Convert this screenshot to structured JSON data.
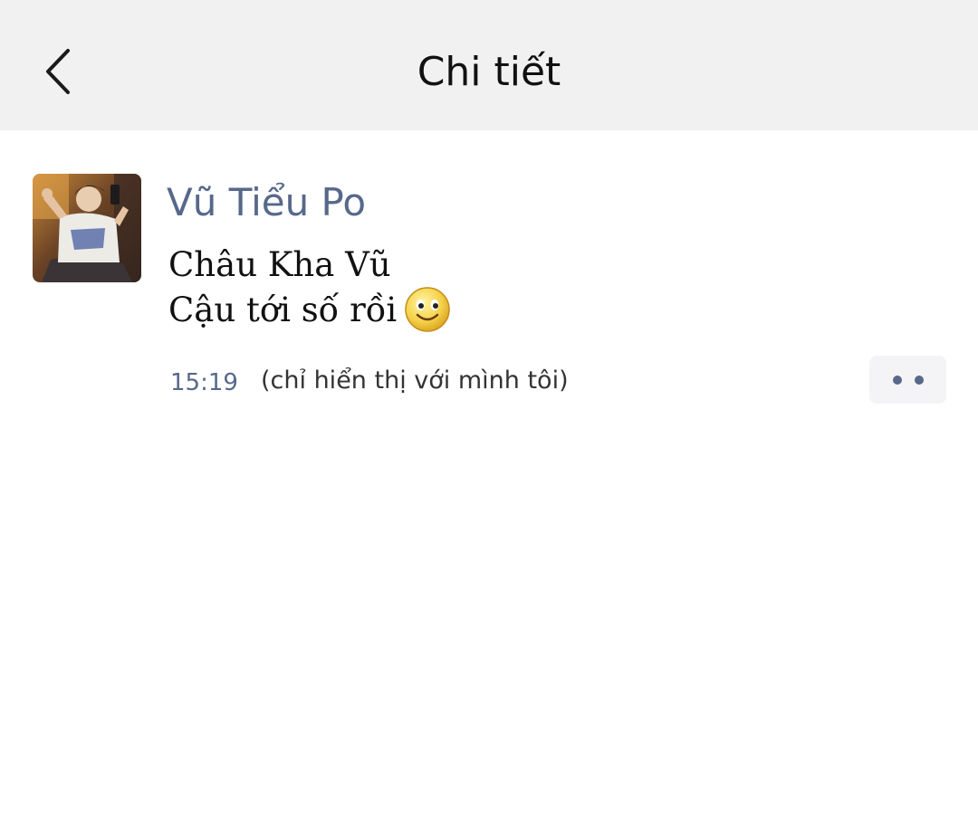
{
  "header": {
    "title": "Chi tiết",
    "back_icon": "chevron-left-icon"
  },
  "post": {
    "author": "Vũ Tiểu Po",
    "message_lines": [
      "Châu Kha Vũ",
      "Cậu tới số rồi"
    ],
    "emoji": "smile-emoji",
    "time": "15:19",
    "visibility_note": "(chỉ hiển thị với mình tôi)",
    "more_icon": "more-dots-icon"
  },
  "colors": {
    "header_bg": "#f1f1f1",
    "name_color": "#57688a",
    "text_color": "#111111"
  }
}
